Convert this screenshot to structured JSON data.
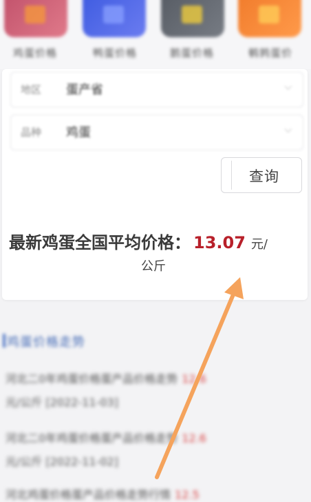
{
  "categories": [
    {
      "label": "鸡蛋价格"
    },
    {
      "label": "鸭蛋价格"
    },
    {
      "label": "鹅蛋价格"
    },
    {
      "label": "鹌鹑蛋价"
    }
  ],
  "form": {
    "region_label": "地区",
    "region_value": "蛋产省",
    "type_label": "品种",
    "type_value": "鸡蛋",
    "query_button": "查询"
  },
  "price": {
    "prefix": "最新鸡蛋全国平均价格：",
    "value": "13.07",
    "unit_part1": "元/",
    "unit_part2": "公斤"
  },
  "news": {
    "section_title": "鸡蛋价格走势",
    "items": [
      {
        "line1": "河北二0年鸡蛋价格蛋产品价格走势",
        "price": "12.6",
        "line2": "元/公斤  [2022-11-03]"
      },
      {
        "line1": "河北二0年鸡蛋价格蛋产品价格走势",
        "price": "12.6",
        "line2": "元/公斤  [2022-11-02]"
      },
      {
        "line1": "河北鸡蛋价格蛋产品价格走势行情",
        "price": "12.5",
        "line2": ""
      }
    ]
  },
  "colors": {
    "price_red": "#b8202a",
    "annotation_arrow": "#f5a35c"
  }
}
